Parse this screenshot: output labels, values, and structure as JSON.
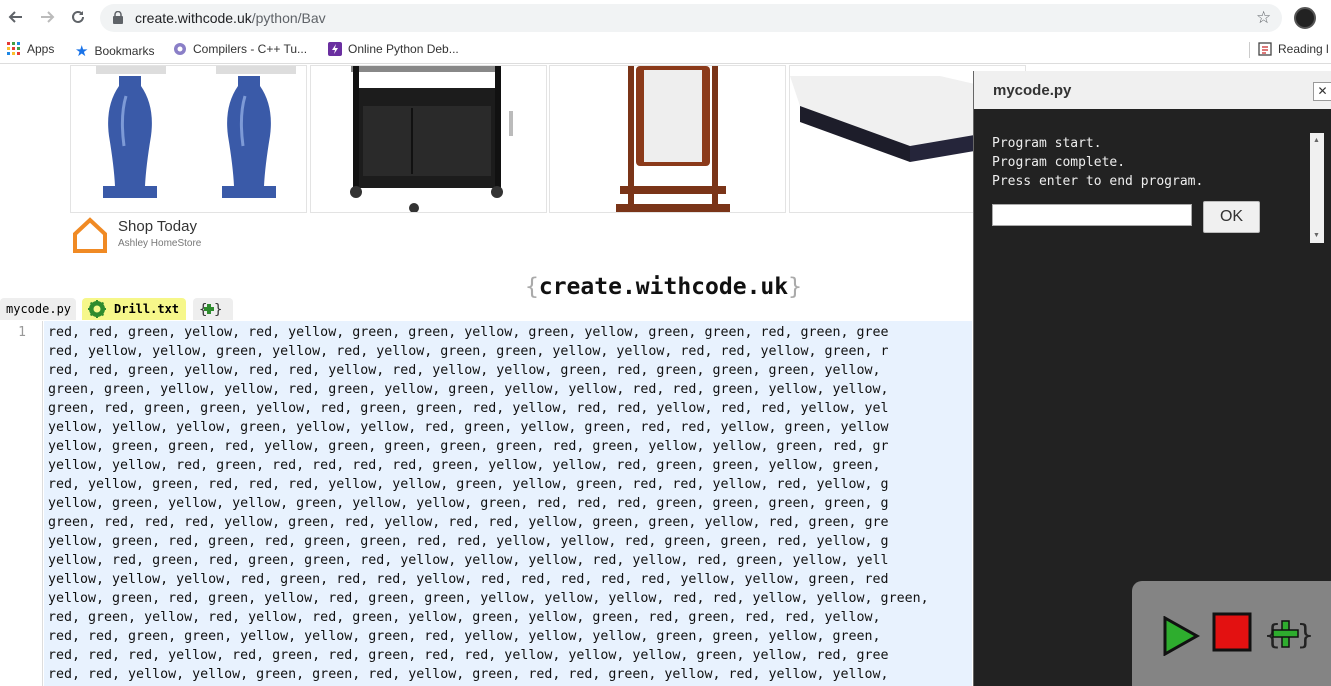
{
  "browser": {
    "url_host": "create.withcode.uk",
    "url_path": "/python/Bav",
    "bookmarks": [
      {
        "label": "Apps",
        "icon": "apps-grid-icon"
      },
      {
        "label": "Bookmarks",
        "icon": "star-icon"
      },
      {
        "label": "Compilers - C++ Tu...",
        "icon": "compilers-icon"
      },
      {
        "label": "Online Python Deb...",
        "icon": "lightning-icon"
      }
    ],
    "reading_list_label": "Reading l"
  },
  "ad": {
    "title": "Shop Today",
    "subtitle": "Ashley HomeStore"
  },
  "brand": {
    "open": "{",
    "text": "create.withcode.uk",
    "close": "}"
  },
  "tabs": [
    {
      "label": "mycode.py"
    },
    {
      "label": "Drill.txt"
    }
  ],
  "editor": {
    "line_number": "1",
    "lines": [
      "red, red, green, yellow, red, yellow, green, green, yellow, green, yellow, green, green, red, green, gree",
      "red, yellow, yellow, green, yellow, red, yellow, green, green, yellow, yellow, red, red, yellow, green, r",
      "red, red, green, yellow, red, red, yellow, red, yellow, yellow, green, red, green, green, green, yellow,",
      "green, green, yellow, yellow, red, green, yellow, green, yellow, yellow, red, red, green, yellow, yellow,",
      "green, red, green, green, yellow, red, green, green, red, yellow, red, red, yellow, red, red, yellow, yel",
      "yellow, yellow, yellow, green, yellow, yellow, red, green, yellow, green, red, red, yellow, green, yellow",
      "yellow, green, green, red, yellow, green, green, green, green, red, green, yellow, yellow, green, red, gr",
      "yellow, yellow, red, green, red, red, red, red, green, yellow, yellow, red, green, green, yellow, green,",
      "red, yellow, green, red, red, red, yellow, yellow, green, yellow, green, red, red, yellow, red, yellow, g",
      "yellow, green, yellow, yellow, green, yellow, yellow, green, red, red, red, green, green, green, green, g",
      "green, red, red, red, yellow, green, red, yellow, red, red, yellow, green, green, yellow, red, green, gre",
      "yellow, green, red, green, red, green, green, red, red, yellow, yellow, red, green, green, red, yellow, g",
      "yellow, red, green, red, green, green, red, yellow, yellow, yellow, red, yellow, red, green, yellow, yell",
      "yellow, yellow, yellow, red, green, red, red, yellow, red, red, red, red, red, yellow, yellow, green, red",
      "yellow, green, red, green, yellow, red, green, green, yellow, yellow, yellow, red, red, yellow, yellow, green,",
      "red, green, yellow, red, yellow, red, green, yellow, green, yellow, green, red, green, red, red, yellow,",
      "red, red, green, green, yellow, yellow, green, red, yellow, yellow, yellow, green, green, yellow, green,",
      "red, red, red, yellow, red, green, red, green, red, red, yellow, yellow, yellow, green, yellow, red, gree",
      "red, red, yellow, yellow, green, green, red, yellow, green, red, red, green, yellow, red, yellow, yellow,"
    ]
  },
  "panel": {
    "title": "mycode.py",
    "close_label": "✕",
    "console_lines": "Program start.\nProgram complete.\nPress enter to end program.",
    "ok_label": "OK"
  },
  "colors": {
    "editor_bg": "#e8f2fe",
    "panel_bg": "#222222",
    "play": "#2fb52f",
    "stop": "#ee1111"
  }
}
